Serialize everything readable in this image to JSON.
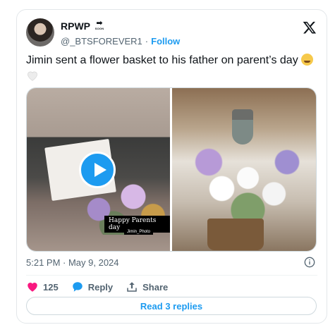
{
  "author": {
    "display_name": "RPWP",
    "badge_arrow": "➡",
    "badge_text": "SOON",
    "handle": "@_BTSFOREVER1",
    "separator": "·",
    "follow_label": "Follow"
  },
  "tweet": {
    "text": "Jimin sent a flower basket to his father on parent’s day"
  },
  "media": {
    "caption": "Happy Parents day",
    "caption_sub": "Jimin_Photo"
  },
  "meta": {
    "timestamp": "5:21 PM · May 9, 2024"
  },
  "actions": {
    "like_count": "125",
    "reply_label": "Reply",
    "share_label": "Share"
  },
  "read_replies_label": "Read 3 replies",
  "colors": {
    "accent": "#1d9bf0",
    "like": "#f91880",
    "text_secondary": "#536471"
  }
}
